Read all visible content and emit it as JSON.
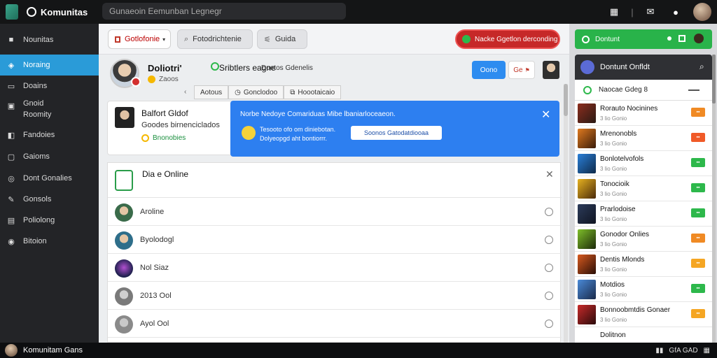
{
  "app": {
    "title": "Komunitas"
  },
  "top_search": {
    "text": "Gunaeoin Eemunban Legnegr"
  },
  "sidebar": {
    "items": [
      {
        "label": "Nounitas",
        "icon": "home-icon",
        "active": false
      },
      {
        "label": "Noraing",
        "icon": "compass-icon",
        "active": true
      },
      {
        "label": "Doains",
        "icon": "message-icon",
        "active": false
      },
      {
        "label": "Gnoid",
        "label2": "Roomity",
        "icon": "grid-icon",
        "active": false
      },
      {
        "label": "Fandoies",
        "icon": "tag-icon",
        "active": false
      },
      {
        "label": "Gaioms",
        "icon": "square-icon",
        "active": false
      },
      {
        "label": "Dont Gonalies",
        "icon": "gamepad-icon",
        "active": false
      },
      {
        "label": "Gonsols",
        "icon": "tools-icon",
        "active": false
      },
      {
        "label": "Poliolong",
        "icon": "box-icon",
        "active": false
      },
      {
        "label": "Bitoion",
        "icon": "info-icon",
        "active": false
      }
    ]
  },
  "toolbar": {
    "filter_label": "Gotlofonie",
    "search_label": "Fotodrichtenie",
    "guide_label": "Guida",
    "cta_label": "Nacke Ggetlon derconding"
  },
  "profile": {
    "name": "Doliotri'",
    "status": "Sribtlers eagne",
    "subtitle": "Doetos Gdenelis",
    "coins": "Zaoos",
    "primary_button": "Oono",
    "flag_button": "Ge"
  },
  "subtabs": [
    "Aotous",
    "Gonclodoo",
    "Hoootaicaio"
  ],
  "card": {
    "title": "Balfort Gldof",
    "subtitle": "Goodes birnenciclados",
    "coins": "Bnonobies"
  },
  "banner": {
    "title": "Norbe Nedoye Comariduas Mibe lbaniarloceaeon.",
    "line1": "Tesooto ofo om diniebotan.",
    "line2": "Dolyeopgd aht bontiorrr.",
    "button": "Soonos Gatodatdiooaa"
  },
  "online_list": {
    "title": "Dia e Online",
    "rows": [
      {
        "label": "Aroline"
      },
      {
        "label": "Byolodogl"
      },
      {
        "label": "Nol Siaz"
      },
      {
        "label": "2013 Ool"
      },
      {
        "label": "Ayol Ool"
      }
    ]
  },
  "right_panel": {
    "top_label": "Dontunt",
    "head_title": "Dontunt Onfldt",
    "sub_title": "Naocae Gdeg 8",
    "items": [
      {
        "title": "Rorauto Nocinines",
        "meta": "3 lio Gonio",
        "tag_color": "#f08a24"
      },
      {
        "title": "Mrenonobls",
        "meta": "3 lio Gonio",
        "tag_color": "#f05a28"
      },
      {
        "title": "Bonlotelvofols",
        "meta": "3 lio Gonio",
        "tag_color": "#2db84b"
      },
      {
        "title": "Tonocioik",
        "meta": "3 lio Gonio",
        "tag_color": "#2db84b"
      },
      {
        "title": "Prarlodoise",
        "meta": "3 lio Gonio",
        "tag_color": "#2db84b"
      },
      {
        "title": "Gonodor Onlies",
        "meta": "3 lio Gonio",
        "tag_color": "#f08a24"
      },
      {
        "title": "Dentis Mlonds",
        "meta": "3 lio Gonio",
        "tag_color": "#f5a623"
      },
      {
        "title": "Motdios",
        "meta": "3 lio Gonio",
        "tag_color": "#2db84b"
      },
      {
        "title": "Bonnoobmtdis Gonaer",
        "meta": "3 lio Gonio",
        "tag_color": "#f5a623"
      },
      {
        "title": "Dolitnon",
        "meta": "",
        "tag_color": ""
      }
    ]
  },
  "bottombar": {
    "user_label": "Komunitam Gans",
    "status": "GfA GAD"
  },
  "colors": {
    "accent": "#2a9bd8",
    "cta_red": "#c62828",
    "green": "#2db84b",
    "banner_blue": "#2d7ff0"
  }
}
